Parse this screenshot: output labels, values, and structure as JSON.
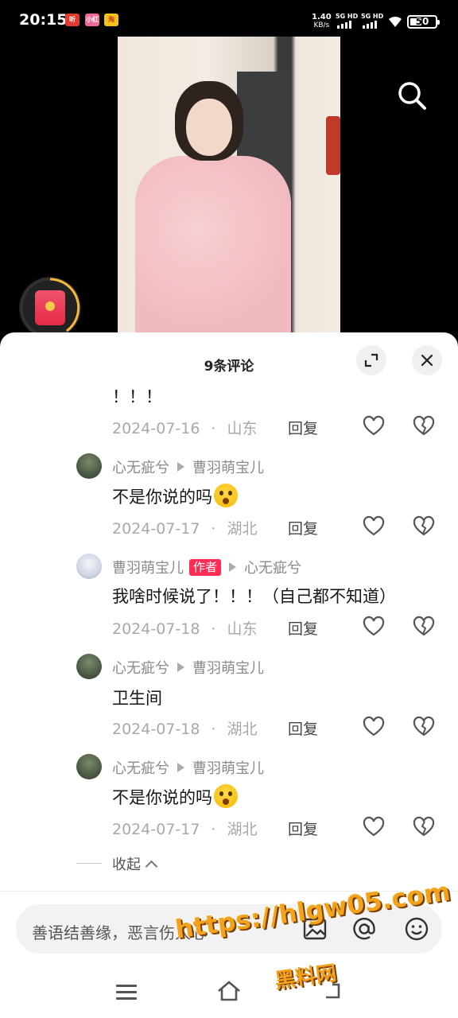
{
  "status_bar": {
    "time": "20:15",
    "app_icons": [
      "听",
      "小红书",
      "淘"
    ],
    "net_speed_value": "1.40",
    "net_speed_unit": "KB/s",
    "signal_1": "5G HD",
    "signal_2": "5G HD",
    "battery": "50"
  },
  "video": {
    "search_icon": "search-icon",
    "redpacket_icon": "red-packet-icon"
  },
  "comments_panel": {
    "title": "9条评论",
    "expand_icon": "expand-icon",
    "close_icon": "close-icon",
    "reply_label": "回复",
    "collapse_label": "收起",
    "comments": [
      {
        "text": "！！！",
        "date": "2024-07-16",
        "location": "山东"
      },
      {
        "user": "心无疵兮",
        "reply_to": "曹羽萌宝儿",
        "text": "不是你说的吗",
        "date": "2024-07-17",
        "location": "湖北"
      },
      {
        "user": "曹羽萌宝儿",
        "author_tag": "作者",
        "reply_to": "心无疵兮",
        "text": "我啥时候说了！！！（自己都不知道）",
        "date": "2024-07-18",
        "location": "山东"
      },
      {
        "user": "心无疵兮",
        "reply_to": "曹羽萌宝儿",
        "text": "卫生间",
        "date": "2024-07-18",
        "location": "湖北"
      },
      {
        "user": "心无疵兮",
        "reply_to": "曹羽萌宝儿",
        "text": "不是你说的吗",
        "date": "2024-07-17",
        "location": "湖北"
      }
    ]
  },
  "input": {
    "placeholder": "善语结善缘，恶言伤人心",
    "icons": [
      "image-icon",
      "at-icon",
      "emoji-icon"
    ]
  },
  "watermark": {
    "url": "https://hlgw05.com",
    "name": "黑料网"
  },
  "nav_bar": {
    "icons": [
      "menu-icon",
      "home-icon",
      "back-icon"
    ]
  }
}
